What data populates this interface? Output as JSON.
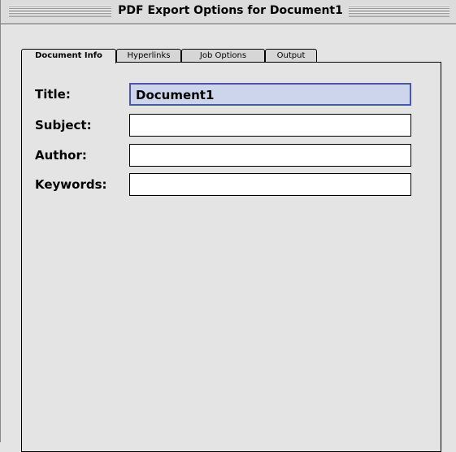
{
  "window": {
    "title": "PDF Export Options for Document1"
  },
  "tabs": [
    {
      "label": "Document Info",
      "active": true
    },
    {
      "label": "Hyperlinks",
      "active": false
    },
    {
      "label": "Job Options",
      "active": false
    },
    {
      "label": "Output",
      "active": false
    }
  ],
  "document_info": {
    "title_label": "Title:",
    "title_value": "Document1",
    "subject_label": "Subject:",
    "subject_value": "",
    "author_label": "Author:",
    "author_value": "",
    "keywords_label": "Keywords:",
    "keywords_value": ""
  },
  "colors": {
    "focus_border": "#4a5aa0",
    "focus_fill": "#ccd5ec"
  }
}
